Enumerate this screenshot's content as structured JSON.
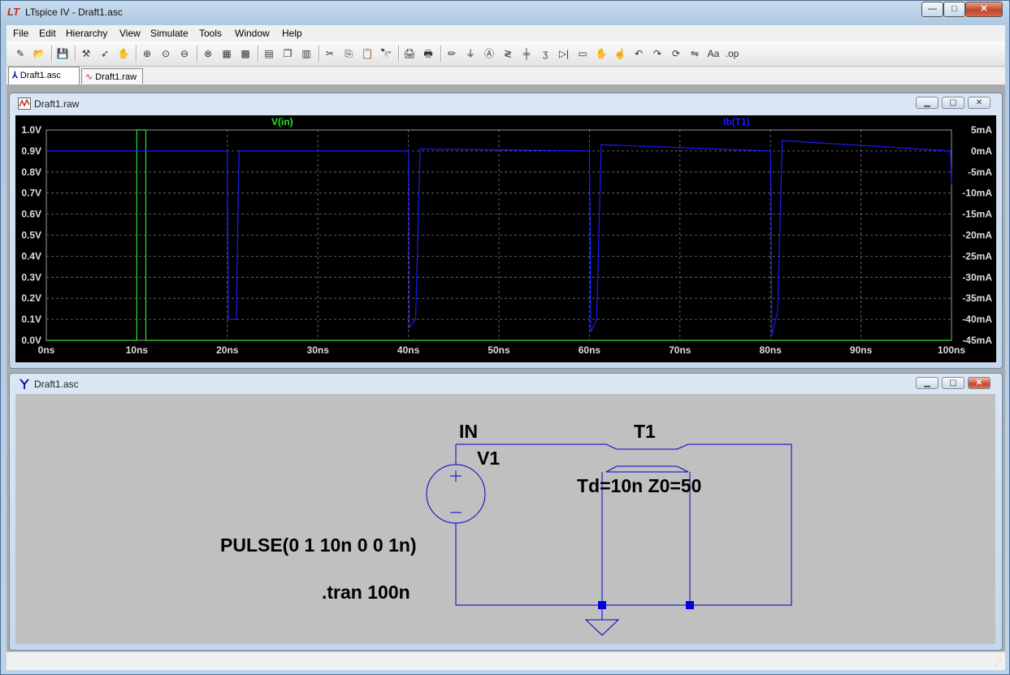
{
  "window": {
    "title": "LTspice IV - Draft1.asc",
    "logo": "LT"
  },
  "caption_buttons": {
    "minimize": "—",
    "maximize": "□",
    "close": "✕"
  },
  "menu": [
    {
      "label": "File"
    },
    {
      "label": "Edit"
    },
    {
      "label": "Hierarchy"
    },
    {
      "label": "View"
    },
    {
      "label": "Simulate"
    },
    {
      "label": "Tools"
    },
    {
      "label": "Window"
    },
    {
      "label": "Help"
    }
  ],
  "toolbar_icons": [
    "new-schematic-icon",
    "open-icon",
    "save-icon",
    "control-panel-icon",
    "run-icon",
    "halt-icon",
    "zoom-in-icon",
    "zoom-full-icon",
    "zoom-out-icon",
    "zoom-extents-icon",
    "autorange-icon",
    "grid-icon",
    "tile-horizontal-icon",
    "cascade-icon",
    "tile-vertical-icon",
    "cut-icon",
    "copy-icon",
    "paste-icon",
    "find-icon",
    "print-setup-icon",
    "print-icon",
    "wire-icon",
    "ground-icon",
    "label-icon",
    "resistor-icon",
    "capacitor-icon",
    "inductor-icon",
    "diode-icon",
    "component-icon",
    "move-icon",
    "drag-icon",
    "undo-icon",
    "redo-icon",
    "rotate-icon",
    "mirror-icon",
    "text-icon",
    "spice-directive-icon"
  ],
  "toolbar_glyphs": [
    "✎",
    "📂",
    "💾",
    "⚒",
    "➶",
    "✋",
    "⊕",
    "⊙",
    "⊖",
    "⊗",
    "▦",
    "▩",
    "▤",
    "❐",
    "▥",
    "✂",
    "⎘",
    "📋",
    "🔭",
    "🖨",
    "🖶",
    "✏",
    "⏚",
    "Ⓐ",
    "≷",
    "╪",
    "ʒ",
    "▷|",
    "▭",
    "✋",
    "☝",
    "↶",
    "↷",
    "⟳",
    "⇋",
    "Aa",
    ".op"
  ],
  "tabs": [
    {
      "label": "Draft1.asc"
    },
    {
      "label": "Draft1.raw"
    }
  ],
  "plot_window": {
    "title": "Draft1.raw"
  },
  "schematic_window": {
    "title": "Draft1.asc"
  },
  "chart_data": {
    "type": "line",
    "x": {
      "label": "",
      "range": [
        0,
        100
      ],
      "unit": "ns",
      "ticks": [
        "0ns",
        "10ns",
        "20ns",
        "30ns",
        "40ns",
        "50ns",
        "60ns",
        "70ns",
        "80ns",
        "90ns",
        "100ns"
      ]
    },
    "y_left": {
      "range": [
        0.0,
        1.0
      ],
      "ticks": [
        "0.0V",
        "0.1V",
        "0.2V",
        "0.3V",
        "0.4V",
        "0.5V",
        "0.6V",
        "0.7V",
        "0.8V",
        "0.9V",
        "1.0V"
      ]
    },
    "y_right": {
      "range": [
        -45,
        5
      ],
      "ticks": [
        "5mA",
        "0mA",
        "-5mA",
        "-10mA",
        "-15mA",
        "-20mA",
        "-25mA",
        "-30mA",
        "-35mA",
        "-40mA",
        "-45mA"
      ]
    },
    "grid": true,
    "series": [
      {
        "name": "V(in)",
        "color": "#2ee02e",
        "axis": "left",
        "points": [
          [
            0,
            0
          ],
          [
            10,
            0
          ],
          [
            10,
            1
          ],
          [
            11,
            1
          ],
          [
            11,
            0
          ],
          [
            100,
            0
          ]
        ]
      },
      {
        "name": "Ib(T1)",
        "color": "#1a1aff",
        "axis": "right",
        "points": [
          [
            0,
            0
          ],
          [
            20,
            0
          ],
          [
            20,
            -2
          ],
          [
            20.05,
            -20
          ],
          [
            20.1,
            -40
          ],
          [
            21,
            -40
          ],
          [
            21.2,
            -10
          ],
          [
            21.3,
            0
          ],
          [
            40,
            0
          ],
          [
            40.05,
            -8
          ],
          [
            40.1,
            -42
          ],
          [
            40.8,
            -40
          ],
          [
            41.3,
            0.5
          ],
          [
            60,
            0
          ],
          [
            60.05,
            -10
          ],
          [
            60.15,
            -43
          ],
          [
            60.8,
            -40
          ],
          [
            61.3,
            1.5
          ],
          [
            80,
            0
          ],
          [
            80.05,
            -10
          ],
          [
            80.15,
            -44
          ],
          [
            80.8,
            -38
          ],
          [
            81.3,
            2.5
          ],
          [
            99.9,
            0
          ],
          [
            100,
            -8
          ]
        ]
      }
    ]
  },
  "schematic": {
    "labels": {
      "net_in": "IN",
      "v1": "V1",
      "t1": "T1",
      "t1_params": "Td=10n Z0=50",
      "pulse": "PULSE(0 1 10n 0 0 1n)",
      "tran": ".tran 100n"
    },
    "colors": {
      "wire": "#0000c8",
      "text": "#000000",
      "background": "#c0c0c0"
    }
  }
}
